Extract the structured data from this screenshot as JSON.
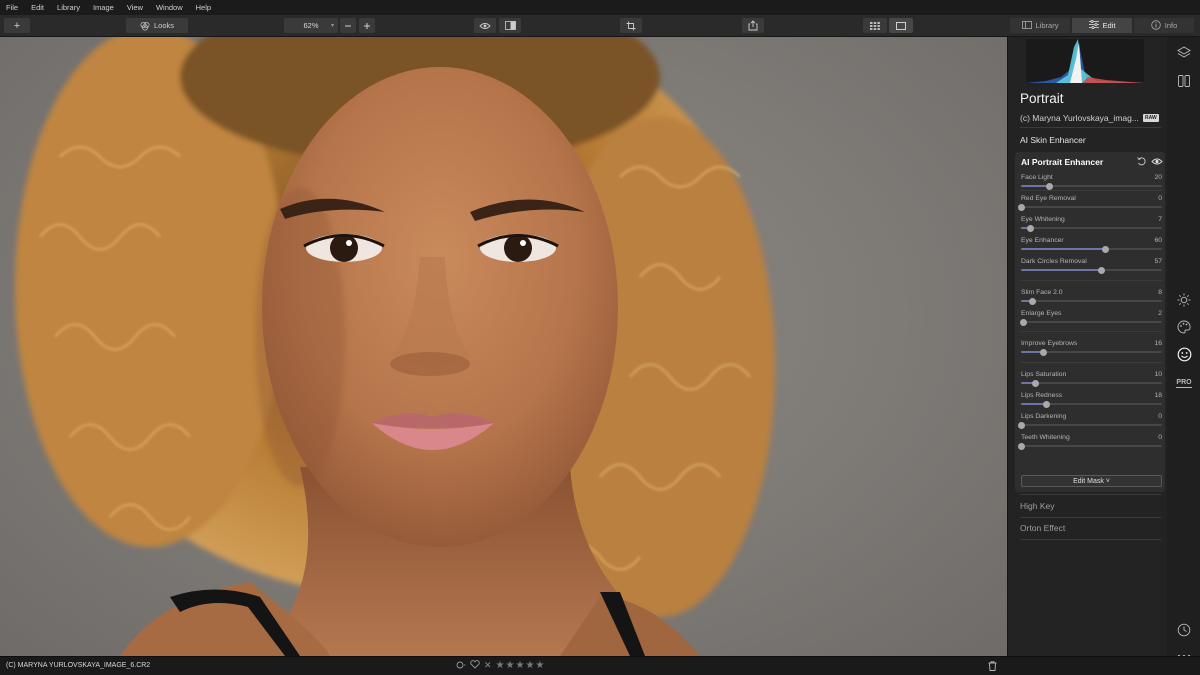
{
  "menu": [
    "File",
    "Edit",
    "Library",
    "Image",
    "View",
    "Window",
    "Help"
  ],
  "toolbar": {
    "add_label": "+",
    "looks_label": "Looks",
    "zoom_value": "62%",
    "tabs": [
      {
        "label": "Library",
        "icon": "library-icon"
      },
      {
        "label": "Edit",
        "icon": "sliders-icon"
      },
      {
        "label": "Info",
        "icon": "info-icon"
      }
    ]
  },
  "panel": {
    "preset_title": "Portrait",
    "file_name": "(c) Maryna Yurlovskaya_imag...",
    "raw_badge": "RAW",
    "sections_above": [
      "AI Skin Enhancer"
    ],
    "tool": {
      "title": "AI Portrait Enhancer",
      "sliders": [
        {
          "label": "Face Light",
          "value": "20",
          "level": 0.2
        },
        {
          "label": "Red Eye Removal",
          "value": "0",
          "level": 0.0
        },
        {
          "label": "Eye Whitening",
          "value": "7",
          "level": 0.07
        },
        {
          "label": "Eye Enhancer",
          "value": "60",
          "level": 0.6
        },
        {
          "label": "Dark Circles Removal",
          "value": "57",
          "level": 0.57
        },
        {
          "label": "Slim Face 2.0",
          "value": "8",
          "level": 0.08
        },
        {
          "label": "Enlarge Eyes",
          "value": "2",
          "level": 0.02
        },
        {
          "label": "Improve Eyebrows",
          "value": "16",
          "level": 0.16
        },
        {
          "label": "Lips Saturation",
          "value": "10",
          "level": 0.1
        },
        {
          "label": "Lips Redness",
          "value": "18",
          "level": 0.18
        },
        {
          "label": "Lips Darkening",
          "value": "0",
          "level": 0.0
        },
        {
          "label": "Teeth Whitening",
          "value": "0",
          "level": 0.0
        }
      ],
      "edit_mask_label": "Edit Mask ˅"
    },
    "sections_below": [
      "High Key",
      "Orton Effect"
    ]
  },
  "rail_icons": [
    "layers-icon",
    "compare-icon",
    "sun-icon",
    "palette-icon",
    "face-icon",
    "pro-icon",
    "history-icon",
    "more-icon"
  ],
  "rail_pro_label": "PRO",
  "status": {
    "file": "(C) MARYNA YURLOVSKAYA_IMAGE_6.CR2",
    "stars": 5,
    "star_glyph": "★",
    "reject_glyph": "✕"
  },
  "colors": {
    "accent": "#6f73a6",
    "panel_bg": "#232323",
    "tool_bg": "#2e2e2e"
  }
}
